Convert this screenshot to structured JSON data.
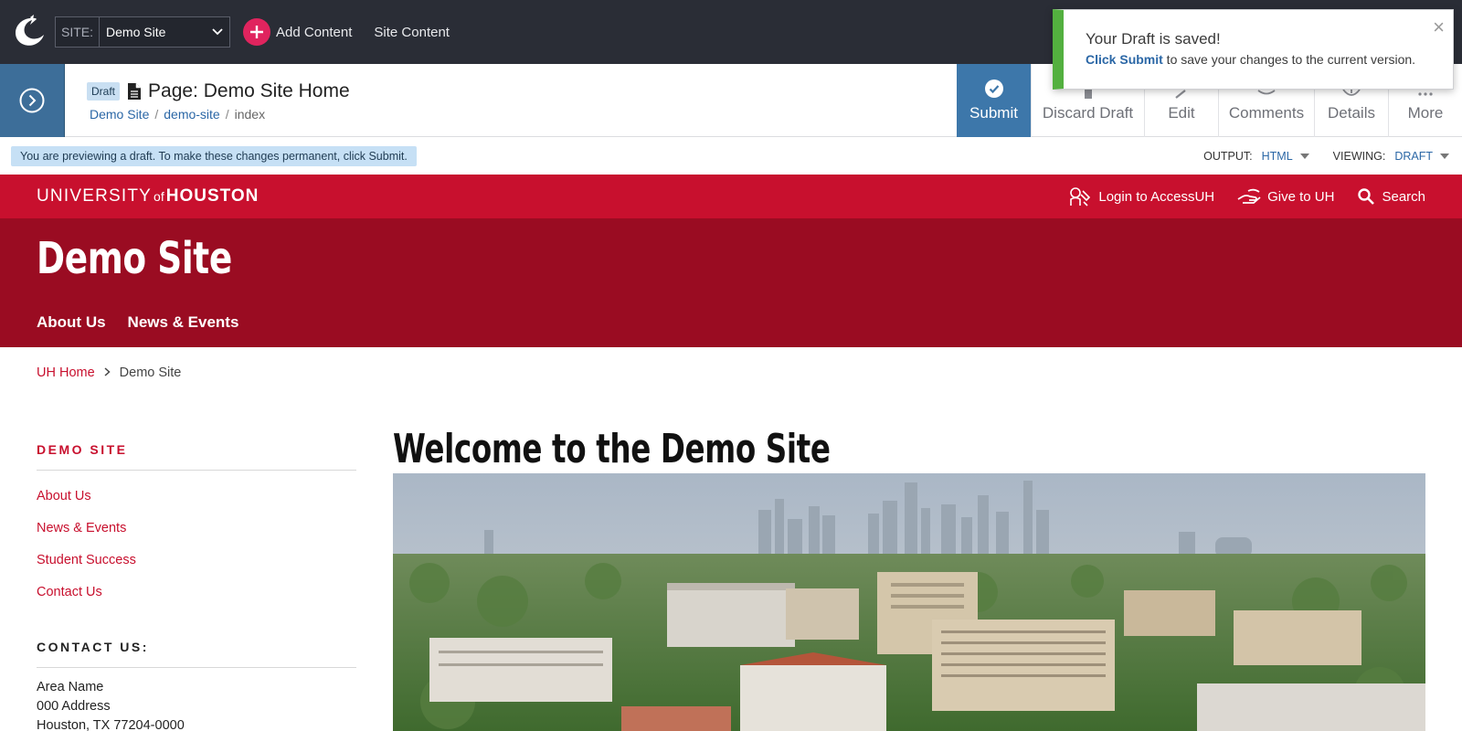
{
  "topbar": {
    "site_label": "SITE:",
    "site_value": "Demo Site",
    "add_content": "Add Content",
    "site_content": "Site Content"
  },
  "pagebar": {
    "status": "Draft",
    "title": "Page: Demo Site Home",
    "breadcrumb": [
      "Demo Site",
      "demo-site",
      "index"
    ],
    "actions": {
      "submit": "Submit",
      "discard": "Discard Draft",
      "edit": "Edit",
      "comments": "Comments",
      "details": "Details",
      "more": "More"
    }
  },
  "toast": {
    "title": "Your Draft is saved!",
    "link": "Click Submit",
    "message": " to save your changes to the current version.",
    "close": "×"
  },
  "preview": {
    "note": "You are previewing a draft. To make these changes permanent, click Submit.",
    "output_label": "OUTPUT:",
    "output_value": "HTML",
    "viewing_label": "VIEWING:",
    "viewing_value": "DRAFT"
  },
  "uh": {
    "logo_left": "UNIVERSITY",
    "logo_of": "of",
    "logo_right": "HOUSTON",
    "links": [
      "Login to AccessUH",
      "Give to UH",
      "Search"
    ],
    "site_title": "Demo Site",
    "nav": [
      "About Us",
      "News & Events"
    ]
  },
  "content": {
    "breadcrumb_home": "UH Home",
    "breadcrumb_current": "Demo Site",
    "sidenav_title": "DEMO SITE",
    "sidenav_items": [
      "About Us",
      "News & Events",
      "Student Success",
      "Contact Us"
    ],
    "contact_title": "CONTACT US:",
    "contact_lines": [
      "Area Name",
      "000 Address",
      "Houston, TX 77204-0000"
    ],
    "heading": "Welcome to the Demo Site"
  },
  "colors": {
    "uh_red": "#c8102e",
    "uh_dark_red": "#9a0c22",
    "cms_dark": "#2a2d36",
    "cms_blue": "#3d77aa",
    "toast_green": "#53b03f"
  }
}
